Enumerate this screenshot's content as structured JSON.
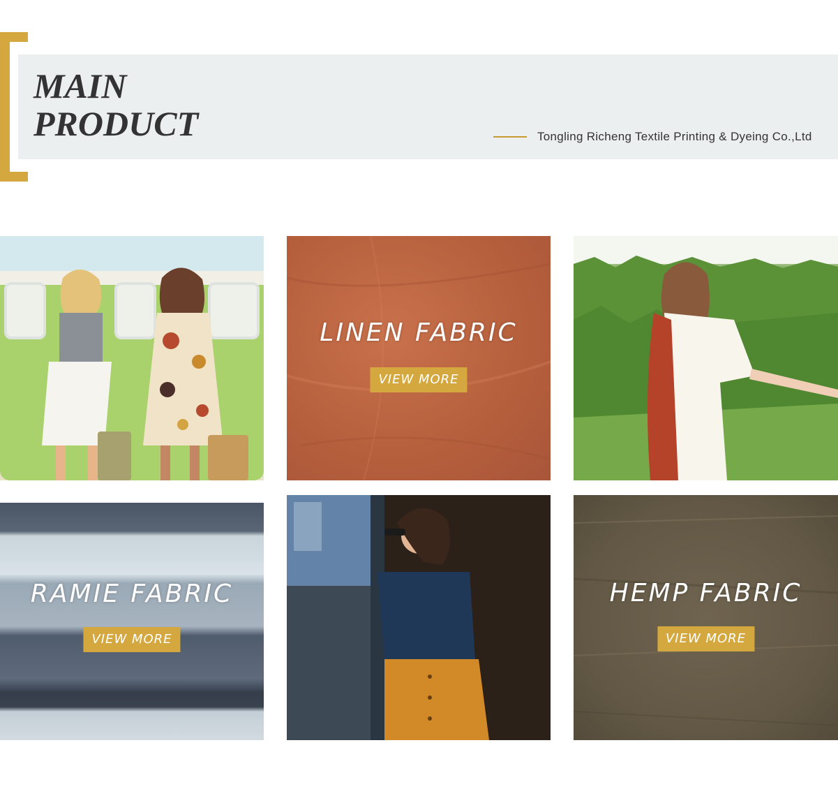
{
  "header": {
    "title_line1": "MAIN",
    "title_line2": "PRODUCT",
    "company": "Tongling Richeng Textile Printing & Dyeing Co.,Ltd",
    "accent_color": "#d4a83e",
    "band_color": "#eceff0"
  },
  "products": [
    {
      "id": "photo-women-van",
      "label": "",
      "button": ""
    },
    {
      "id": "linen",
      "label": "LINEN FABRIC",
      "button": "VIEW MORE"
    },
    {
      "id": "photo-woman-forest",
      "label": "",
      "button": ""
    },
    {
      "id": "ramie",
      "label": "RAMIE FABRIC",
      "button": "VIEW MORE"
    },
    {
      "id": "photo-woman-doorway",
      "label": "",
      "button": ""
    },
    {
      "id": "hemp",
      "label": "HEMP FABRIC",
      "button": "VIEW MORE"
    }
  ]
}
